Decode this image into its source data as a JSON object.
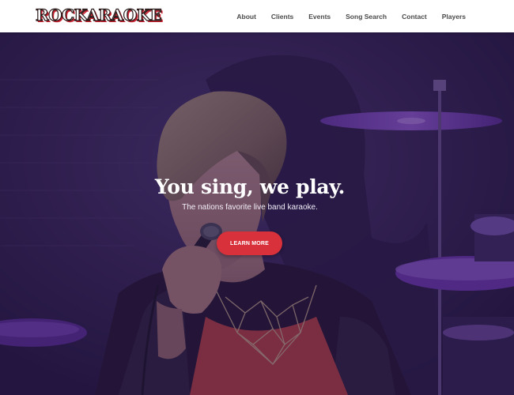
{
  "header": {
    "logo_text": "ROCKARAOKE",
    "nav": [
      {
        "label": "About"
      },
      {
        "label": "Clients"
      },
      {
        "label": "Events"
      },
      {
        "label": "Song Search"
      },
      {
        "label": "Contact"
      },
      {
        "label": "Players"
      }
    ]
  },
  "hero": {
    "headline": "You sing, we play.",
    "subline": "The nations favorite live band karaoke.",
    "cta_label": "LEARN MORE",
    "background_icon": "singer-photo"
  },
  "colors": {
    "cta": "#d8313b",
    "overlay": "#2c1852",
    "header_bg": "#ffffff",
    "nav_text": "#4a4a4a"
  }
}
